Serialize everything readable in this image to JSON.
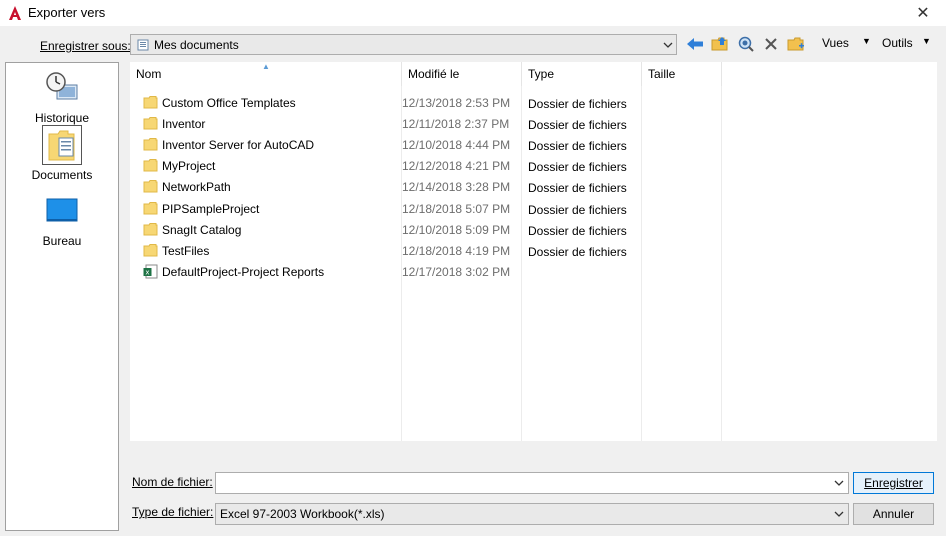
{
  "window": {
    "title": "Exporter vers",
    "close_glyph": "✕"
  },
  "toolbar": {
    "save_in_label": "Enregistrer sous:",
    "location": "Mes documents",
    "back_icon": "back-arrow-icon",
    "up_icon": "up-folder-icon",
    "search_web_icon": "search-web-icon",
    "delete_icon": "delete-icon",
    "new_folder_icon": "new-folder-icon",
    "views_label": "Vues",
    "tools_label": "Outils",
    "dropdown_glyph": "▼"
  },
  "places": [
    {
      "label": "Historique",
      "icon": "history-icon"
    },
    {
      "label": "Documents",
      "icon": "documents-icon",
      "selected": true
    },
    {
      "label": "Bureau",
      "icon": "desktop-icon"
    }
  ],
  "filelist": {
    "columns": [
      "Nom",
      "Modifié le",
      "Type",
      "Taille"
    ],
    "sort_caret": "▲",
    "rows": [
      {
        "name": "Custom Office Templates",
        "modified": "12/13/2018 2:53 PM",
        "type": "Dossier de fichiers",
        "icon": "folder-icon"
      },
      {
        "name": "Inventor",
        "modified": "12/11/2018 2:37 PM",
        "type": "Dossier de fichiers",
        "icon": "folder-icon"
      },
      {
        "name": "Inventor Server for AutoCAD",
        "modified": "12/10/2018 4:44 PM",
        "type": "Dossier de fichiers",
        "icon": "folder-icon"
      },
      {
        "name": "MyProject",
        "modified": "12/12/2018 4:21 PM",
        "type": "Dossier de fichiers",
        "icon": "folder-icon"
      },
      {
        "name": "NetworkPath",
        "modified": "12/14/2018 3:28 PM",
        "type": "Dossier de fichiers",
        "icon": "folder-icon"
      },
      {
        "name": "PIPSampleProject",
        "modified": "12/18/2018 5:07 PM",
        "type": "Dossier de fichiers",
        "icon": "folder-icon"
      },
      {
        "name": "SnagIt Catalog",
        "modified": "12/10/2018 5:09 PM",
        "type": "Dossier de fichiers",
        "icon": "folder-icon"
      },
      {
        "name": "TestFiles",
        "modified": "12/18/2018 4:19 PM",
        "type": "Dossier de fichiers",
        "icon": "folder-icon"
      },
      {
        "name": "DefaultProject-Project Reports",
        "modified": "12/17/2018 3:02 PM",
        "type": "",
        "icon": "excel-file-icon"
      }
    ]
  },
  "footer": {
    "filename_label": "Nom de fichier:",
    "filename_value": "",
    "filetype_label": "Type de fichier:",
    "filetype_value": "Excel 97-2003 Workbook(*.xls)",
    "save_button": "Enregistrer",
    "cancel_button": "Annuler",
    "combo_arrow": "⌄"
  },
  "colors": {
    "folder": "#f7d774",
    "folder_edge": "#e0b847",
    "accent": "#0078d7",
    "excel": "#1d7244",
    "app_red": "#c8102e"
  }
}
